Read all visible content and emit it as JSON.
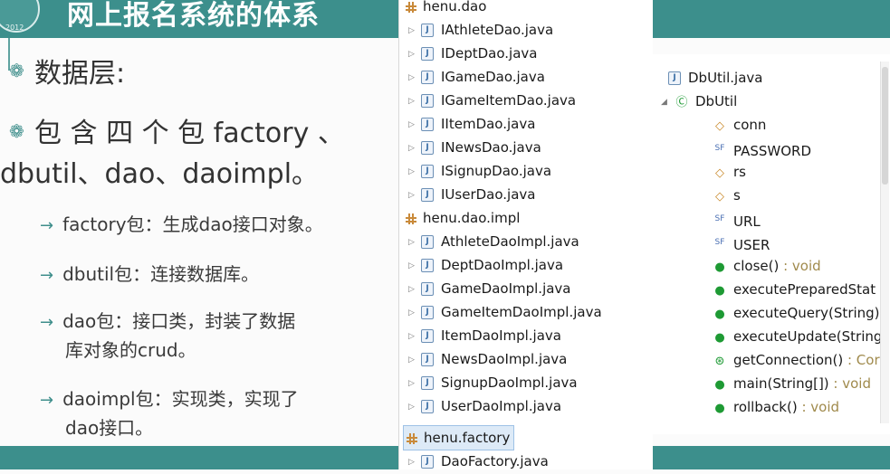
{
  "slide": {
    "title": "网上报名系统的体系",
    "logo_year": "2012",
    "bullet1": "数据层:",
    "bullet2_line1": "包 含 四 个 包 factory 、",
    "bullet2_line2": "dbutil、dao、daoimpl。",
    "subs": [
      {
        "line1": "factory包：生成dao接口对象。",
        "line2": ""
      },
      {
        "line1": "dbutil包：连接数据库。",
        "line2": ""
      },
      {
        "line1": "dao包：接口类，封装了数据",
        "line2": "库对象的crud。"
      },
      {
        "line1": "daoimpl包：实现类，实现了",
        "line2": "dao接口。"
      }
    ],
    "arrow": "→",
    "bullet_icon": "❁"
  },
  "package_tree": {
    "packages": [
      {
        "name": "henu.dao",
        "files": [
          "IAthleteDao.java",
          "IDeptDao.java",
          "IGameDao.java",
          "IGameItemDao.java",
          "IItemDao.java",
          "INewsDao.java",
          "ISignupDao.java",
          "IUserDao.java"
        ]
      },
      {
        "name": "henu.dao.impl",
        "files": [
          "AthleteDaoImpl.java",
          "DeptDaoImpl.java",
          "GameDaoImpl.java",
          "GameItemDaoImpl.java",
          "ItemDaoImpl.java",
          "NewsDaoImpl.java",
          "SignupDaoImpl.java",
          "UserDaoImpl.java"
        ]
      },
      {
        "name": "henu.factory",
        "files": [
          "DaoFactory.java"
        ]
      }
    ]
  },
  "outline": {
    "file": "DbUtil.java",
    "class": "DbUtil",
    "members": [
      {
        "icon": "field-static",
        "name": "conn",
        "type": ""
      },
      {
        "icon": "field-final",
        "name": "PASSWORD",
        "type": ""
      },
      {
        "icon": "field-static",
        "name": "rs",
        "type": ""
      },
      {
        "icon": "field-static",
        "name": "s",
        "type": ""
      },
      {
        "icon": "field-final",
        "name": "URL",
        "type": ""
      },
      {
        "icon": "field-final",
        "name": "USER",
        "type": ""
      },
      {
        "icon": "method-static",
        "name": "close()",
        "type": " : void"
      },
      {
        "icon": "method-static",
        "name": "executePreparedStat",
        "type": ""
      },
      {
        "icon": "method-static",
        "name": "executeQuery(String)",
        "type": ""
      },
      {
        "icon": "method-static",
        "name": "executeUpdate(String",
        "type": ""
      },
      {
        "icon": "method-static-special",
        "name": "getConnection()",
        "type": " : Cor"
      },
      {
        "icon": "method-static",
        "name": "main(String[])",
        "type": " : void"
      },
      {
        "icon": "method-static",
        "name": "rollback()",
        "type": " : void"
      }
    ]
  },
  "colors": {
    "teal": "#3c8f8c",
    "selection": "#ddeaf7"
  }
}
